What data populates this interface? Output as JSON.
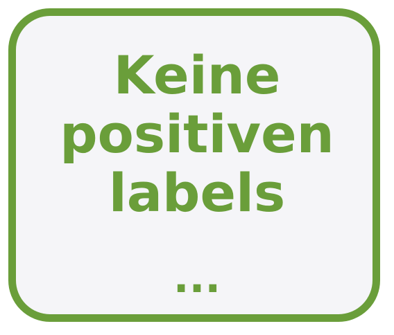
{
  "card": {
    "lines": [
      "Keine",
      "positiven",
      "labels"
    ],
    "ellipsis": "...",
    "accent_color": "#6a9e3a",
    "background_color": "#f5f5f8"
  }
}
